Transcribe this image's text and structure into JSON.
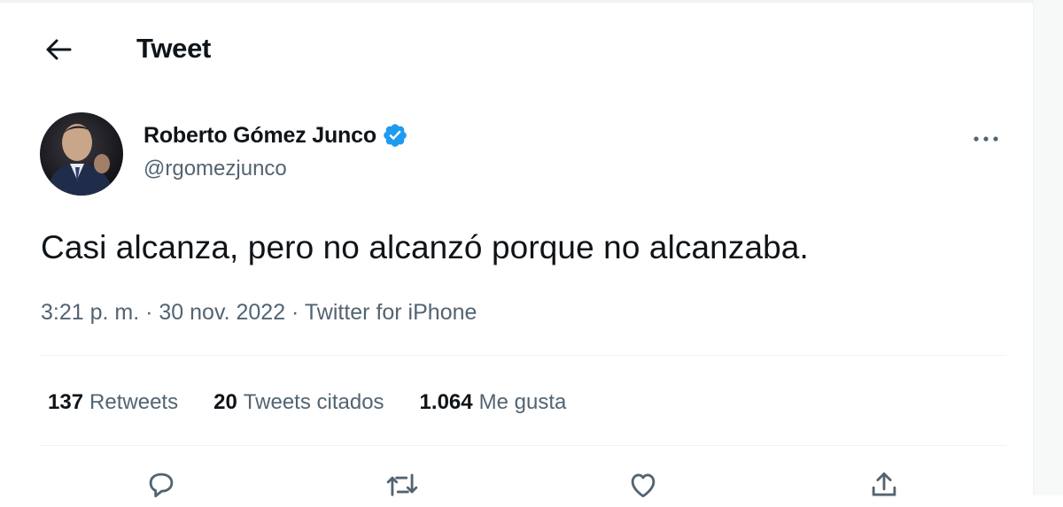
{
  "header": {
    "title": "Tweet",
    "back_icon": "arrow-left-icon"
  },
  "author": {
    "name": "Roberto Gómez Junco",
    "handle": "@rgomezjunco",
    "verified": true,
    "verified_color": "#1d9bf0"
  },
  "tweet": {
    "text": "Casi alcanza, pero no alcanzó porque no alcanzaba.",
    "time": "3:21 p. m.",
    "date": "30 nov. 2022",
    "source": "Twitter for iPhone"
  },
  "stats": [
    {
      "count": "137",
      "label": "Retweets"
    },
    {
      "count": "20",
      "label": "Tweets citados"
    },
    {
      "count": "1.064",
      "label": "Me gusta"
    }
  ],
  "actions": [
    "reply-icon",
    "retweet-icon",
    "like-icon",
    "share-icon"
  ],
  "colors": {
    "text_primary": "#0f1419",
    "text_secondary": "#536471",
    "divider": "#eff3f4"
  }
}
